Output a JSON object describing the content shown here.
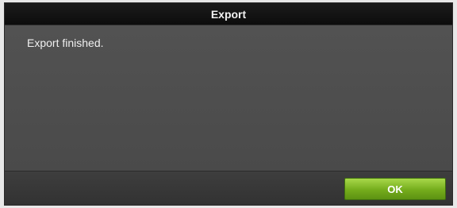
{
  "dialog": {
    "title": "Export",
    "message": "Export finished.",
    "ok_label": "OK"
  },
  "colors": {
    "title_bar": "#0c0c0c",
    "body": "#4b4b4b",
    "ok_button": "#74ac1c"
  }
}
